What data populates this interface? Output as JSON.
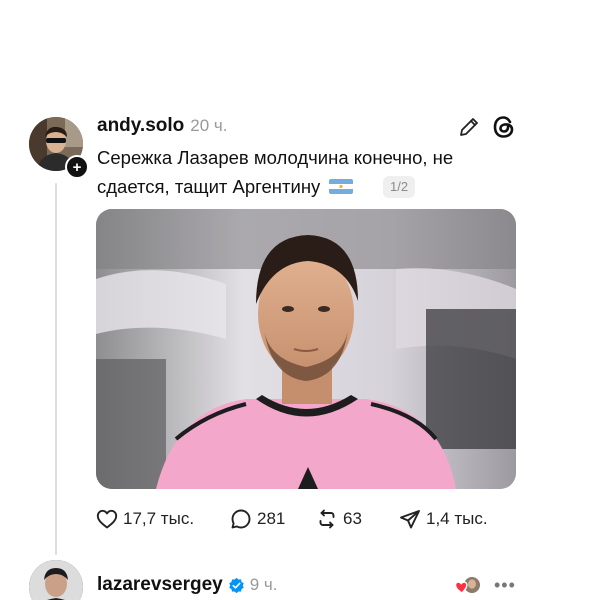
{
  "post": {
    "username": "andy.solo",
    "time": "20 ч.",
    "text_line1": "Сережка Лазарев молодчина конечно, не",
    "text_line2": "сдается, тащит Аргентину",
    "flag_icon": "argentina-flag",
    "image_counter": "1/2",
    "follow_symbol": "+",
    "stats": {
      "likes": "17,7 тыс.",
      "comments": "281",
      "reposts": "63",
      "shares": "1,4 тыс."
    },
    "icons": [
      "edit-pencil-icon",
      "threads-logo-icon",
      "heart-icon",
      "comment-icon",
      "repost-icon",
      "share-icon"
    ]
  },
  "reply": {
    "username": "lazarevsergey",
    "time": "9 ч.",
    "more_symbol": "•••",
    "icons": [
      "verified-badge-icon",
      "liked-by-author-icon",
      "more-icon"
    ]
  },
  "colors": {
    "text": "#111111",
    "muted": "#9a9a9a",
    "verified": "#0095f6",
    "shirt_pink": "#f3a7cb"
  }
}
